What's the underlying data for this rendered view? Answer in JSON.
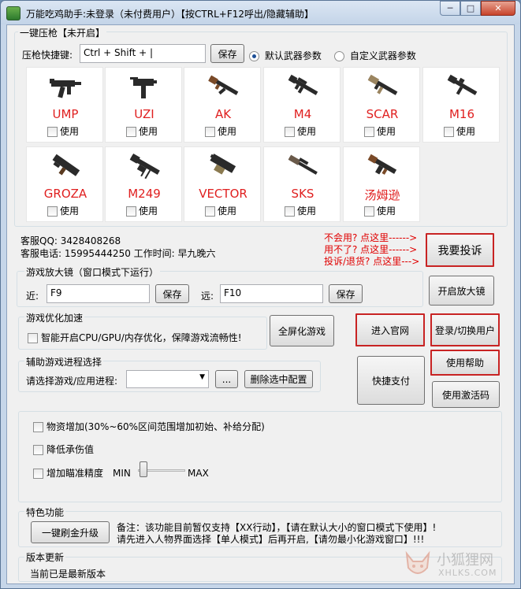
{
  "window": {
    "title": "万能吃鸡助手:未登录（未付费用户）【按CTRL+F12呼出/隐藏辅助】",
    "min": "─",
    "max": "□",
    "close": "✕"
  },
  "recoil": {
    "group_label": "一键压枪【未开启】",
    "hotkey_label": "压枪快捷键:",
    "hotkey_value": "Ctrl + Shift + |",
    "save_label": "保存",
    "radio_default": "默认武器参数",
    "radio_custom": "自定义武器参数",
    "weapons": [
      {
        "name": "UMP",
        "use": "使用"
      },
      {
        "name": "UZI",
        "use": "使用"
      },
      {
        "name": "AK",
        "use": "使用"
      },
      {
        "name": "M4",
        "use": "使用"
      },
      {
        "name": "SCAR",
        "use": "使用"
      },
      {
        "name": "M16",
        "use": "使用"
      },
      {
        "name": "GROZA",
        "use": "使用"
      },
      {
        "name": "M249",
        "use": "使用"
      },
      {
        "name": "VECTOR",
        "use": "使用"
      },
      {
        "name": "SKS",
        "use": "使用"
      },
      {
        "name": "汤姆逊",
        "use": "使用"
      }
    ]
  },
  "support": {
    "qq": "客服QQ:  3428408268",
    "phone": "客服电话:  15995444250  工作时间:  早九晚六",
    "hint1": "不会用? 点这里------>",
    "hint2": "用不了? 点这里------>",
    "hint3": "投诉/退货? 点这里--->",
    "complain_btn": "我要投诉"
  },
  "magnifier": {
    "group_label": "游戏放大镜（窗口模式下运行）",
    "near_label": "近:",
    "near_value": "F9",
    "far_label": "远:",
    "far_value": "F10",
    "save1": "保存",
    "save2": "保存",
    "open_btn": "开启放大镜"
  },
  "optimize": {
    "group_label": "游戏优化加速",
    "smart_label": "智能开启CPU/GPU/内存优化，保障游戏流畅性!",
    "fullscreen_btn": "全屏化游戏"
  },
  "buttons": {
    "official": "进入官网",
    "login": "登录/切换用户",
    "help": "使用帮助",
    "pay": "快捷支付",
    "activate": "使用激活码"
  },
  "process": {
    "group_label": "辅助游戏进程选择",
    "select_label": "请选择游戏/应用进程:",
    "selected": "",
    "browse": "...",
    "delete_btn": "删除选中配置"
  },
  "options": {
    "supply": "物资增加(30%~60%区间范围增加初始、补给分配)",
    "reduce_damage": "降低承伤值",
    "aim": "增加瞄准精度",
    "min": "MIN",
    "max": "MAX",
    "aim_level": 0
  },
  "special": {
    "group_label": "特色功能",
    "btn": "一键刷金升级",
    "note1": "备注：该功能目前暂仅支持【XX行动】，【请在默认大小的窗口模式下使用】!",
    "note2": "请先进入人物界面选择【单人模式】后再开启,【请勿最小化游戏窗口】!!!"
  },
  "update": {
    "group_label": "版本更新",
    "status": "当前已是最新版本"
  },
  "watermark": {
    "cn": "小狐狸网",
    "en": "XHLKS.COM"
  },
  "colors": {
    "red": "#c82323",
    "weapon_name": "#e02020"
  }
}
